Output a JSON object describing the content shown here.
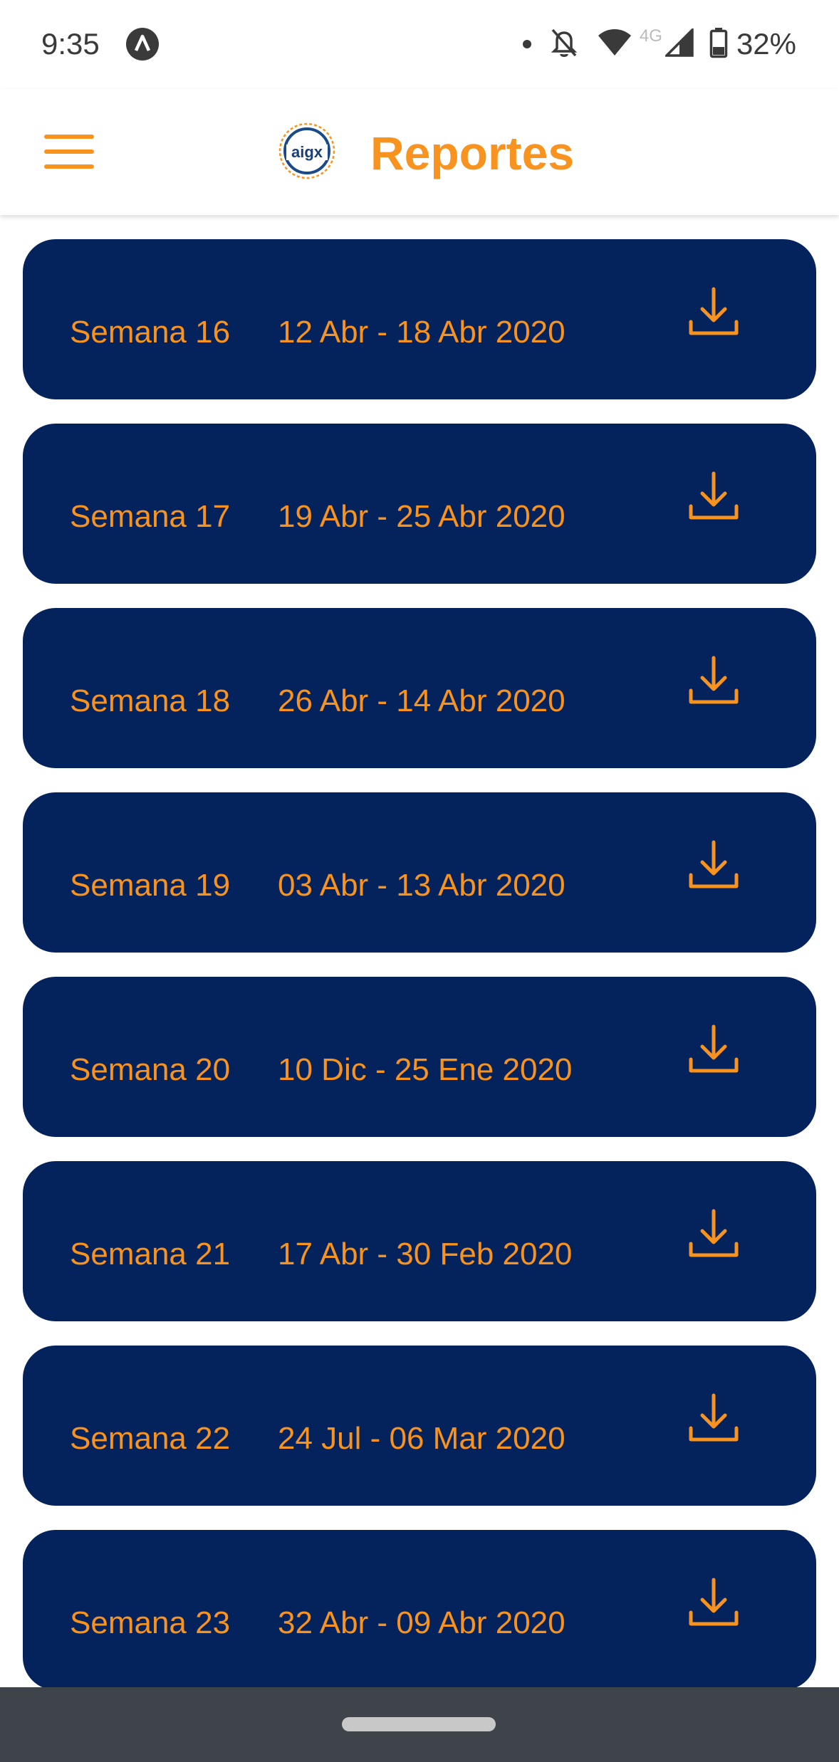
{
  "status_bar": {
    "time": "9:35",
    "battery": "32%",
    "network": "4G",
    "icons": [
      "notification-dot-icon",
      "bell-off-icon",
      "wifi-icon",
      "signal-icon",
      "battery-icon"
    ]
  },
  "header": {
    "title": "Reportes",
    "logo_text": "aigx",
    "menu_icon": "hamburger-menu-icon"
  },
  "colors": {
    "accent": "#f7931e",
    "card_background": "#04225b",
    "nav_bar": "#3e444a"
  },
  "reports": [
    {
      "week": "Semana 16",
      "range": "12 Abr - 18 Abr 2020",
      "icon": "download-icon"
    },
    {
      "week": "Semana 17",
      "range": "19 Abr - 25 Abr 2020",
      "icon": "download-icon"
    },
    {
      "week": "Semana 18",
      "range": "26 Abr - 14 Abr 2020",
      "icon": "download-icon"
    },
    {
      "week": "Semana 19",
      "range": "03 Abr - 13 Abr 2020",
      "icon": "download-icon"
    },
    {
      "week": "Semana 20",
      "range": "10 Dic - 25 Ene 2020",
      "icon": "download-icon"
    },
    {
      "week": "Semana 21",
      "range": "17 Abr - 30 Feb 2020",
      "icon": "download-icon"
    },
    {
      "week": "Semana 22",
      "range": "24 Jul - 06 Mar 2020",
      "icon": "download-icon"
    },
    {
      "week": "Semana 23",
      "range": "32 Abr - 09 Abr 2020",
      "icon": "download-icon"
    }
  ]
}
